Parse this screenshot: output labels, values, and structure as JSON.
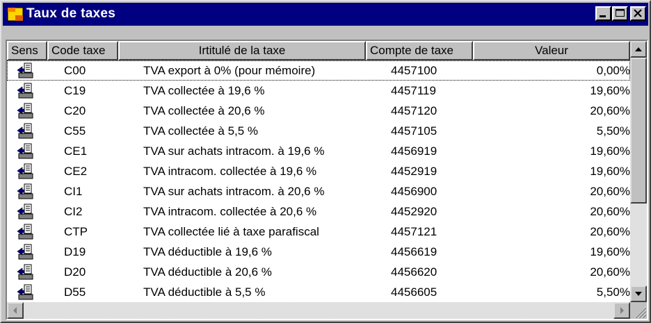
{
  "window": {
    "title": "Taux de taxes",
    "title_bar_color": "#000080",
    "icon": "folder-app-icon"
  },
  "columns": {
    "sens": "Sens",
    "code": "Code taxe",
    "intitule": "Irtitulé de la taxe",
    "compte": "Compte de taxe",
    "valeur": "Valeur"
  },
  "rows": [
    {
      "sens_icon": "document-arrow-icon",
      "code": "C00",
      "intitule": "TVA export à 0% (pour mémoire)",
      "compte": "4457100",
      "valeur": "0,00%"
    },
    {
      "sens_icon": "document-arrow-icon",
      "code": "C19",
      "intitule": "TVA collectée à 19,6 %",
      "compte": "4457119",
      "valeur": "19,60%"
    },
    {
      "sens_icon": "document-arrow-icon",
      "code": "C20",
      "intitule": "TVA collectée à 20,6 %",
      "compte": "4457120",
      "valeur": "20,60%"
    },
    {
      "sens_icon": "document-arrow-icon",
      "code": "C55",
      "intitule": "TVA collectée à 5,5 %",
      "compte": "4457105",
      "valeur": "5,50%"
    },
    {
      "sens_icon": "document-arrow-icon",
      "code": "CE1",
      "intitule": "TVA sur achats intracom. à 19,6 %",
      "compte": "4456919",
      "valeur": "19,60%"
    },
    {
      "sens_icon": "document-arrow-icon",
      "code": "CE2",
      "intitule": "TVA intracom. collectée à 19,6 %",
      "compte": "4452919",
      "valeur": "19,60%"
    },
    {
      "sens_icon": "document-arrow-icon",
      "code": "CI1",
      "intitule": "TVA sur achats intracom. à 20,6 %",
      "compte": "4456900",
      "valeur": "20,60%"
    },
    {
      "sens_icon": "document-arrow-icon",
      "code": "CI2",
      "intitule": "TVA intracom. collectée à 20,6 %",
      "compte": "4452920",
      "valeur": "20,60%"
    },
    {
      "sens_icon": "document-arrow-icon",
      "code": "CTP",
      "intitule": "TVA collectée lié à taxe parafiscal",
      "compte": "4457121",
      "valeur": "20,60%"
    },
    {
      "sens_icon": "document-arrow-icon",
      "code": "D19",
      "intitule": "TVA déductible à 19,6 %",
      "compte": "4456619",
      "valeur": "19,60%"
    },
    {
      "sens_icon": "document-arrow-icon",
      "code": "D20",
      "intitule": "TVA déductible à 20,6 %",
      "compte": "4456620",
      "valeur": "20,60%"
    },
    {
      "sens_icon": "document-arrow-icon",
      "code": "D55",
      "intitule": "TVA déductible à 5,5 %",
      "compte": "4456605",
      "valeur": "5,50%"
    }
  ]
}
